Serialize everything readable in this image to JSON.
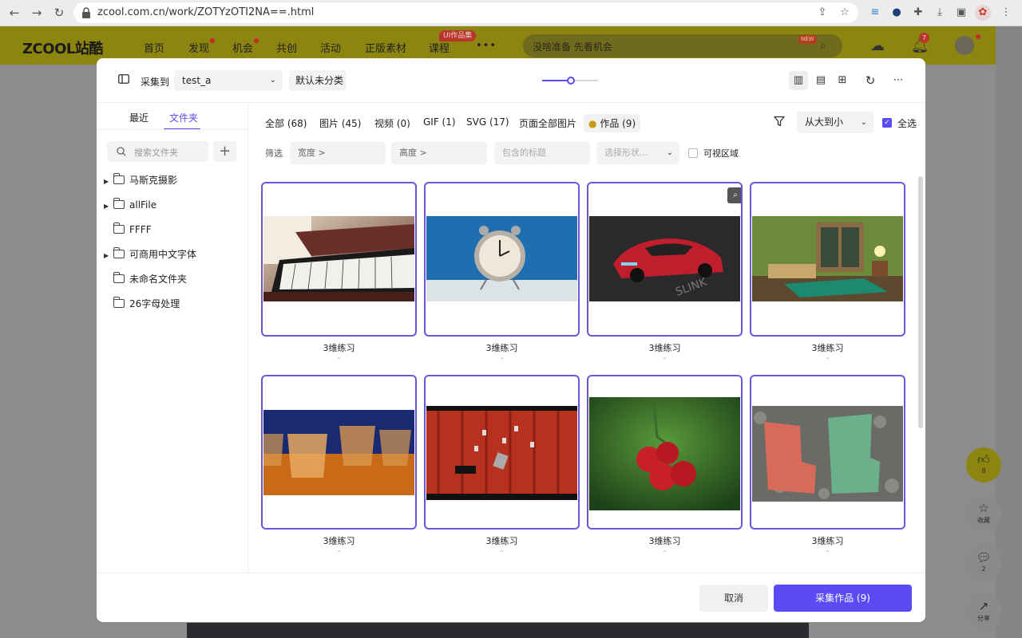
{
  "browser": {
    "url": "zcool.com.cn/work/ZOTYzOTI2NA==.html"
  },
  "site": {
    "logo": "ZCOOL站酷",
    "nav": [
      "首页",
      "发现",
      "机会",
      "共创",
      "活动",
      "正版素材",
      "课程"
    ],
    "more": "•••",
    "ui_badge": "UI作品集",
    "search_placeholder": "没啥准备 先看机会",
    "new_badge": "NEW",
    "notification_count": "7",
    "side_like_count": "8",
    "side_collect_label": "收藏",
    "side_comment_count": "2",
    "side_share_label": "分享"
  },
  "modal": {
    "collect_to_label": "采集到",
    "board_value": "test_a",
    "default_category": "默认未分类",
    "left_tabs": [
      "最近",
      "文件夹"
    ],
    "folder_search_placeholder": "搜索文件夹",
    "folders": [
      {
        "name": "马斯克摄影",
        "expandable": true
      },
      {
        "name": "allFile",
        "expandable": true
      },
      {
        "name": "FFFF",
        "expandable": false
      },
      {
        "name": "可商用中文字体",
        "expandable": true
      },
      {
        "name": "未命名文件夹",
        "expandable": false
      },
      {
        "name": "26字母处理",
        "expandable": false
      }
    ],
    "filter_tabs": [
      "全部 (68)",
      "图片 (45)",
      "视频 (0)",
      "GIF (1)",
      "SVG (17)",
      "页面全部图片",
      "作品 (9)"
    ],
    "sort_value": "从大到小",
    "select_all_label": "全选",
    "filter_label": "筛选",
    "width_input": "宽度 >",
    "height_input": "高度 >",
    "title_placeholder": "包含的标题",
    "shape_placeholder": "选择形状...",
    "visible_area_label": "可视区域",
    "cards": [
      {
        "title": "3维练习",
        "sub": "-"
      },
      {
        "title": "3维练习",
        "sub": "-"
      },
      {
        "title": "3维练习",
        "sub": "-"
      },
      {
        "title": "3维练习",
        "sub": "-"
      },
      {
        "title": "3维练习",
        "sub": "-"
      },
      {
        "title": "3维练习",
        "sub": "-"
      },
      {
        "title": "3维练习",
        "sub": "-"
      },
      {
        "title": "3维练习",
        "sub": "-"
      }
    ],
    "cancel_label": "取消",
    "collect_button_label": "采集作品 (9)"
  },
  "colors": {
    "accent": "#5a4bf5",
    "card_border": "#6b57d8"
  }
}
